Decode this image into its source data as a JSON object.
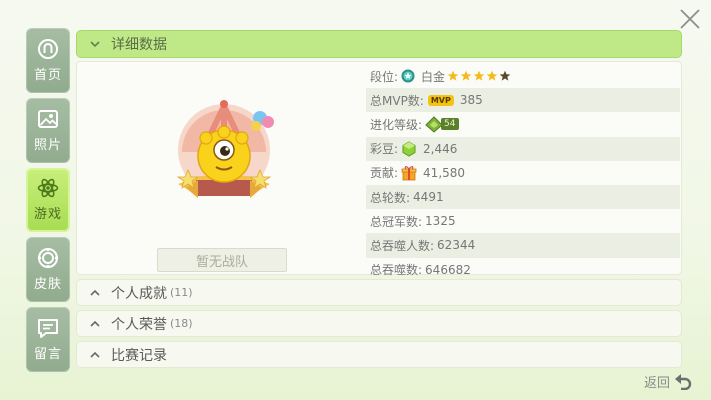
{
  "sidebar": {
    "items": [
      {
        "label": "首页",
        "icon": "home-icon"
      },
      {
        "label": "照片",
        "icon": "photo-icon"
      },
      {
        "label": "游戏",
        "icon": "game-icon",
        "active": true
      },
      {
        "label": "皮肤",
        "icon": "skin-icon"
      },
      {
        "label": "留言",
        "icon": "message-icon"
      }
    ]
  },
  "detail": {
    "title": "详细数据",
    "team": "暂无战队",
    "rank": {
      "label": "段位:",
      "value": "白金",
      "stars": 5
    },
    "mvp": {
      "label": "总MVP数:",
      "badge": "MVP",
      "value": "385"
    },
    "evolution": {
      "label": "进化等级:",
      "level": "54"
    },
    "beans": {
      "label": "彩豆:",
      "value": "2,446"
    },
    "contribution": {
      "label": "贡献:",
      "value": "41,580"
    },
    "rounds": {
      "label": "总轮数:",
      "value": "4491"
    },
    "championships": {
      "label": "总冠军数:",
      "value": "1325"
    },
    "devoured_players": {
      "label": "总吞噬人数:",
      "value": "62344"
    },
    "devoured": {
      "label": "总吞噬数:",
      "value": "646682"
    }
  },
  "sections": [
    {
      "label": "个人成就",
      "count": "(11)"
    },
    {
      "label": "个人荣誉",
      "count": "(18)"
    },
    {
      "label": "比赛记录",
      "count": ""
    }
  ],
  "back_label": "返回",
  "colors": {
    "accent": "#bfe986",
    "nav_inactive": "#9bb398",
    "nav_active": "#b3e36a"
  }
}
